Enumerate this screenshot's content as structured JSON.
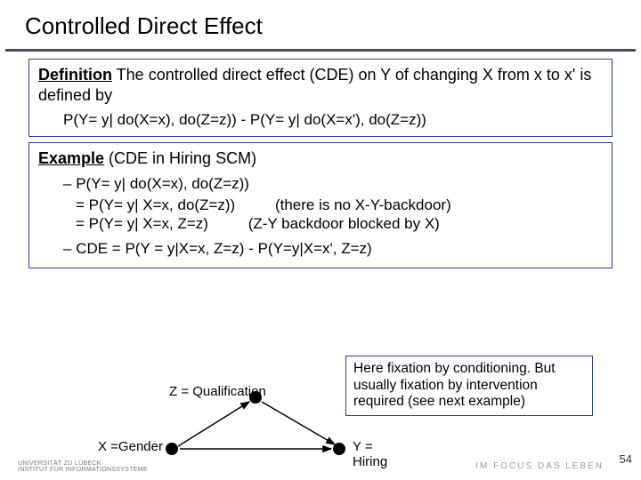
{
  "title": "Controlled Direct Effect",
  "definition": {
    "heading": "Definition",
    "body_a": " The controlled direct effect (CDE) on Y of changing X from x to x' is defined by",
    "formula": "P(Y= y| do(X=x), do(Z=z)) - P(Y= y| do(X=x'), do(Z=z))"
  },
  "example": {
    "heading": "Example",
    "heading_tail": " (CDE in Hiring SCM)",
    "items": [
      "P(Y= y| do(X=x), do(Z=z))",
      "CDE = P(Y = y|X=x, Z=z) - P(Y=y|X=x', Z=z)"
    ],
    "eqrows": [
      {
        "lhs": "=  P(Y= y| X=x, do(Z=z))",
        "note": "(there is no X-Y-backdoor)"
      },
      {
        "lhs": "=  P(Y= y| X=x, Z=z)",
        "note": "(Z-Y backdoor blocked by X)"
      }
    ]
  },
  "graph": {
    "z": "Z = Qualification",
    "x": "X =Gender",
    "y": "Y  =  Hiring"
  },
  "callout": "Here fixation by conditioning. But usually fixation by intervention required (see next example)",
  "footer": {
    "left_top": "UNIVERSITÄT ZU LÜBECK",
    "left_bottom": "INSTITUT FÜR INFORMATIONSSYSTEME",
    "right": "IM FOCUS DAS LEBEN",
    "page": "54"
  }
}
